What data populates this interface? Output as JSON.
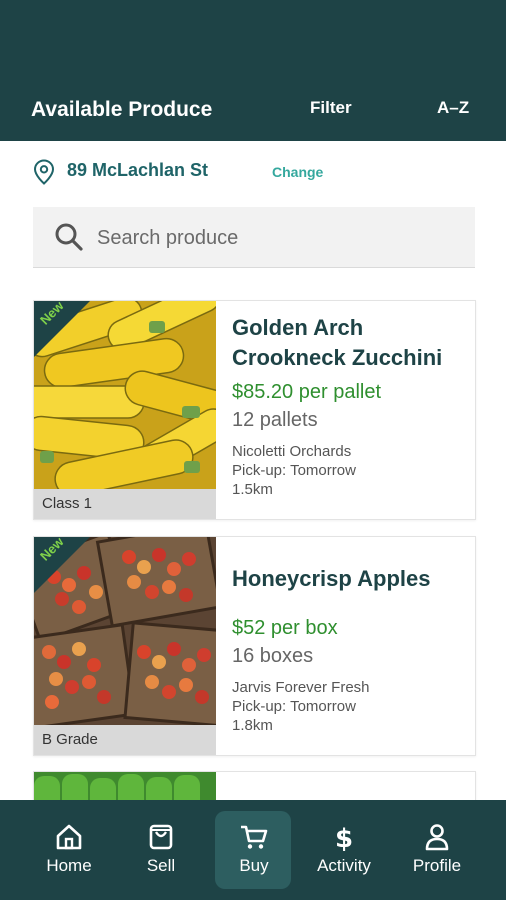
{
  "header": {
    "title": "Available Produce",
    "filter_label": "Filter",
    "sort_label": "A–Z"
  },
  "location": {
    "address": "89 McLachlan St",
    "change_label": "Change",
    "icon": "location-pin-icon"
  },
  "search": {
    "placeholder": "Search produce",
    "value": "",
    "icon": "search-icon"
  },
  "listings": [
    {
      "badge": "New",
      "name": "Golden Arch Crookneck Zucchini",
      "price": "$85.20 per pallet",
      "quantity": "12 pallets",
      "seller": "Nicoletti Orchards",
      "pickup": "Pick-up: Tomorrow",
      "distance": "1.5km",
      "grade": "Class 1"
    },
    {
      "badge": "New",
      "name": "Honeycrisp Apples",
      "price": "$52 per box",
      "quantity": "16 boxes",
      "seller": "Jarvis Forever Fresh",
      "pickup": "Pick-up: Tomorrow",
      "distance": "1.8km",
      "grade": "B Grade"
    }
  ],
  "nav": {
    "items": [
      {
        "label": "Home",
        "icon": "home-icon"
      },
      {
        "label": "Sell",
        "icon": "shopping-bag-icon"
      },
      {
        "label": "Buy",
        "icon": "cart-icon",
        "active": true
      },
      {
        "label": "Activity",
        "icon": "dollar-icon"
      },
      {
        "label": "Profile",
        "icon": "user-icon"
      }
    ]
  },
  "colors": {
    "primary": "#1e4346",
    "accent": "#35a89e",
    "price": "#2f8f2f",
    "new_badge": "#7fd14a"
  }
}
